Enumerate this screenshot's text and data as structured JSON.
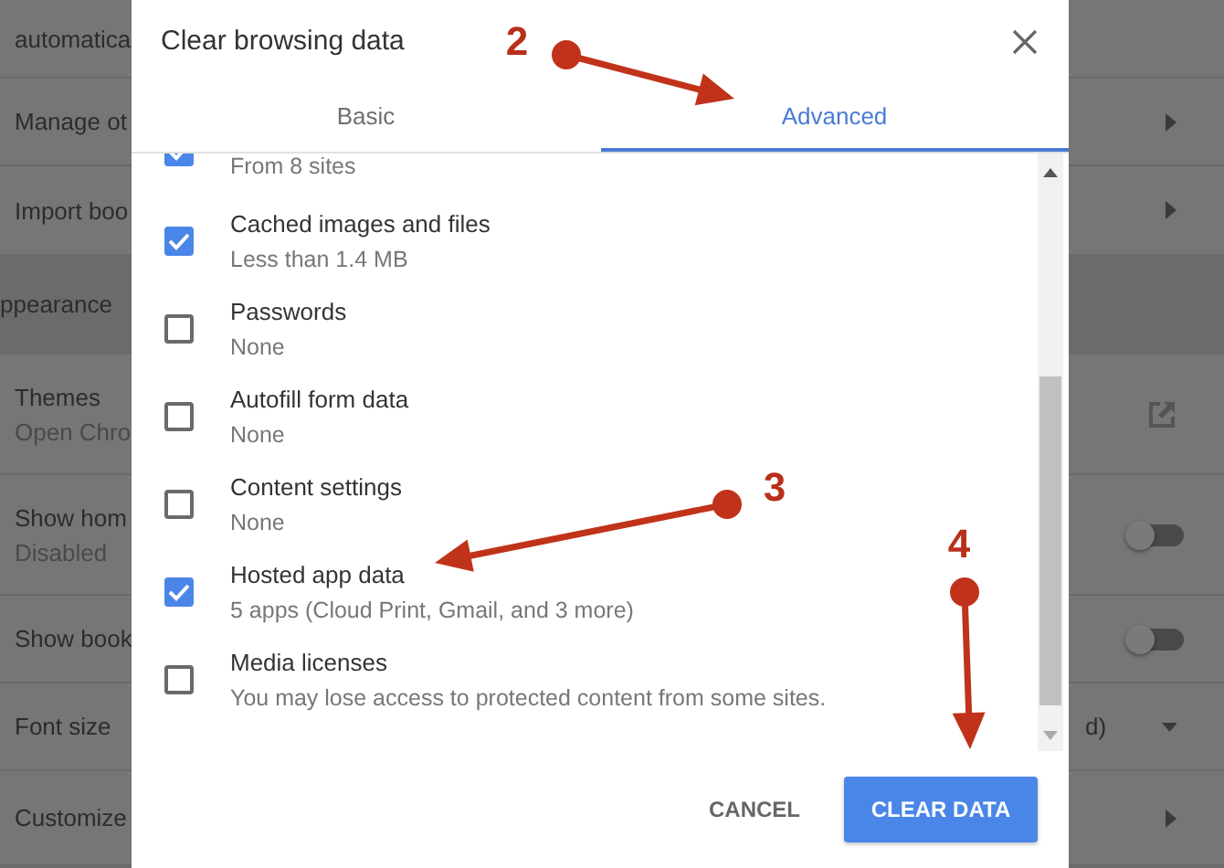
{
  "settings_page": {
    "rows": [
      {
        "kind": "plain",
        "label": "automatica"
      },
      {
        "kind": "arrow",
        "label": "Manage ot"
      },
      {
        "kind": "arrow",
        "label": "Import boo"
      },
      {
        "kind": "section",
        "label": "ppearance"
      },
      {
        "kind": "external",
        "label": "Themes",
        "detail": "Open Chro"
      },
      {
        "kind": "toggle",
        "label": "Show hom",
        "detail": "Disabled",
        "on": false
      },
      {
        "kind": "toggle",
        "label": "Show book",
        "on": false
      },
      {
        "kind": "dropdown",
        "label": "Font size",
        "value": "d)"
      },
      {
        "kind": "arrow",
        "label": "Customize"
      }
    ]
  },
  "dialog": {
    "title": "Clear browsing data",
    "tabs": [
      {
        "label": "Basic",
        "selected": false
      },
      {
        "label": "Advanced",
        "selected": true
      }
    ],
    "items": [
      {
        "detail": "From 8 sites",
        "checked": true
      },
      {
        "label": "Cached images and files",
        "detail": "Less than 1.4 MB",
        "checked": true
      },
      {
        "label": "Passwords",
        "detail": "None",
        "checked": false
      },
      {
        "label": "Autofill form data",
        "detail": "None",
        "checked": false
      },
      {
        "label": "Content settings",
        "detail": "None",
        "checked": false
      },
      {
        "label": "Hosted app data",
        "detail": "5 apps (Cloud Print, Gmail, and 3 more)",
        "checked": true
      },
      {
        "label": "Media licenses",
        "detail": "You may lose access to protected content from some sites.",
        "checked": false
      }
    ],
    "buttons": [
      {
        "label": "CANCEL",
        "kind": "text"
      },
      {
        "label": "CLEAR DATA",
        "kind": "primary"
      }
    ]
  },
  "annotations": [
    {
      "number": "2"
    },
    {
      "number": "3"
    },
    {
      "number": "4"
    }
  ]
}
